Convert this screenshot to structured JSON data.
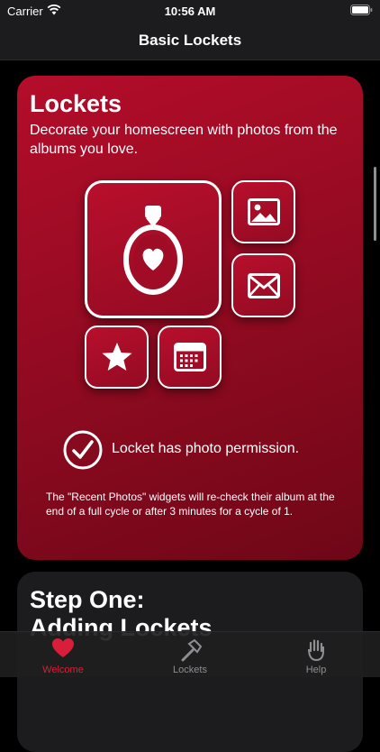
{
  "status_bar": {
    "carrier": "Carrier",
    "time": "10:56 AM"
  },
  "nav": {
    "title": "Basic Lockets"
  },
  "card": {
    "title": "Lockets",
    "description": "Decorate your homescreen with photos from the albums you love.",
    "widgets": [
      {
        "icon": "locket-heart-icon"
      },
      {
        "icon": "photo-icon"
      },
      {
        "icon": "envelope-icon"
      },
      {
        "icon": "star-icon"
      },
      {
        "icon": "calendar-icon"
      }
    ],
    "permission_text": "Locket has photo permission.",
    "note": "The \"Recent Photos\" widgets will re-check their album at the end of a full cycle or after 3 minutes for a cycle of 1."
  },
  "card2": {
    "title_line1": "Step One:",
    "title_line2": "Adding Lockets"
  },
  "tabs": [
    {
      "label": "Welcome",
      "icon": "heart-icon",
      "selected": true
    },
    {
      "label": "Lockets",
      "icon": "hammer-icon",
      "selected": false
    },
    {
      "label": "Help",
      "icon": "hand-icon",
      "selected": false
    }
  ],
  "colors": {
    "accent": "#d81e3a",
    "card": "#a00c25",
    "background": "#000000"
  }
}
